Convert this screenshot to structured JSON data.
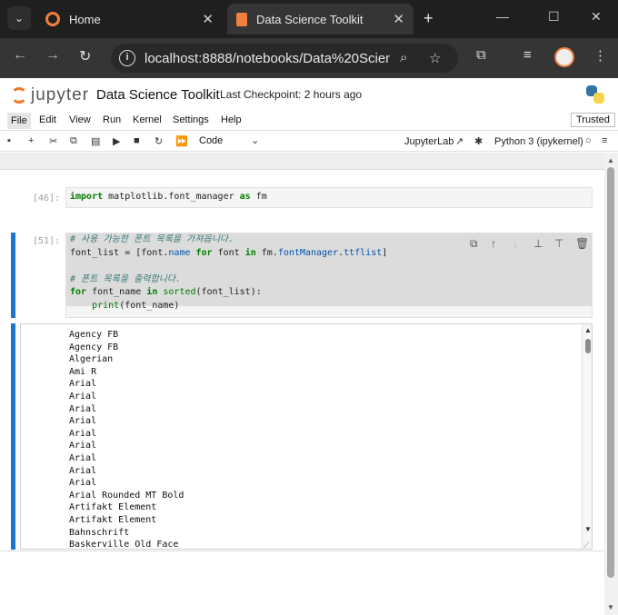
{
  "browser": {
    "tabs": [
      {
        "title": "Home",
        "close": "✕"
      },
      {
        "title": "Data Science Toolkit",
        "close": "✕"
      }
    ],
    "new_tab": "+",
    "window_controls": {
      "minimize": "—",
      "maximize": "☐",
      "close": "✕"
    },
    "url": "localhost:8888/notebooks/Data%20Scien..."
  },
  "jupyter": {
    "logo_text": "jupyter",
    "notebook_title": "Data Science Toolkit",
    "checkpoint": "Last Checkpoint: 2 hours ago",
    "menu": [
      "File",
      "Edit",
      "View",
      "Run",
      "Kernel",
      "Settings",
      "Help"
    ],
    "trusted": "Trusted",
    "toolbar": {
      "cell_type": "Code",
      "jupyterlab_link": "JupyterLab",
      "kernel": "Python 3 (ipykernel)"
    }
  },
  "cells": [
    {
      "prompt": "[46]:"
    },
    {
      "prompt": "[51]:"
    }
  ],
  "output_lines": [
    "Agency FB",
    "Agency FB",
    "Algerian",
    "Ami R",
    "Arial",
    "Arial",
    "Arial",
    "Arial",
    "Arial",
    "Arial",
    "Arial",
    "Arial",
    "Arial",
    "Arial Rounded MT Bold",
    "Artifakt Element",
    "Artifakt Element",
    "Bahnschrift",
    "Baskerville Old Face"
  ],
  "colors": {
    "accent": "#1976d2",
    "jupyter_orange": "#f37626"
  }
}
